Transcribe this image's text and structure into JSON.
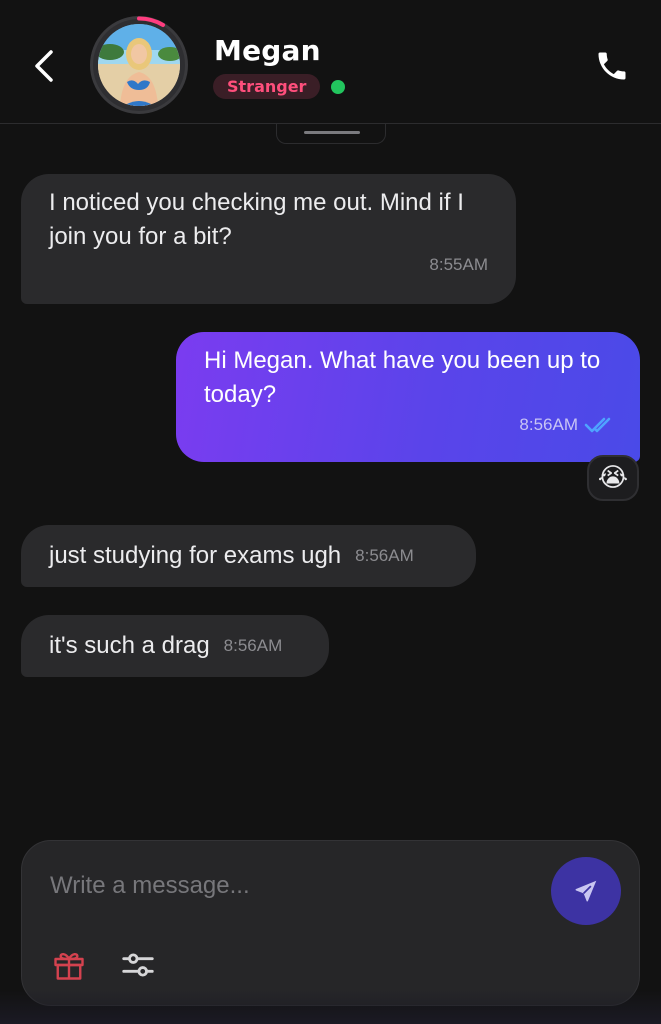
{
  "header": {
    "contact_name": "Megan",
    "status_badge": "Stranger",
    "online": true
  },
  "messages": [
    {
      "direction": "incoming",
      "text": "I noticed you checking me out. Mind if I join you for a bit?",
      "time": "8:55AM"
    },
    {
      "direction": "outgoing",
      "text": "Hi Megan. What have you been up to today?",
      "time": "8:56AM",
      "read": true,
      "reaction": "😭"
    },
    {
      "direction": "incoming",
      "text": "just studying for exams ugh",
      "time": "8:56AM"
    },
    {
      "direction": "incoming",
      "text": "it's such a drag",
      "time": "8:56AM"
    }
  ],
  "composer": {
    "placeholder": "Write a message...",
    "value": ""
  },
  "icons": {
    "back": "chevron-left-icon",
    "call": "phone-icon",
    "send": "send-icon",
    "gift": "gift-icon",
    "settings": "sliders-icon",
    "read_receipt": "double-check-icon"
  },
  "colors": {
    "background": "#121212",
    "incoming_bubble": "#2a2a2c",
    "outgoing_bubble_start": "#7b3cf0",
    "outgoing_bubble_end": "#4a4ae8",
    "badge_text": "#ff4f7c",
    "online": "#22c55e",
    "read_check": "#4fa3ff"
  }
}
